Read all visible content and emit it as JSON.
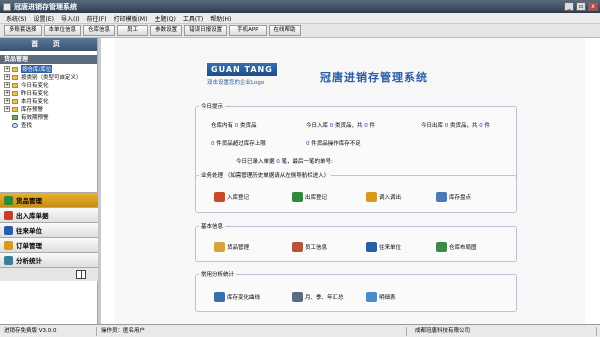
{
  "window": {
    "title": "冠唐进销存管理系统",
    "controls": [
      "_",
      "▫",
      "x"
    ]
  },
  "menubar": [
    "系统(S)",
    "设置(E)",
    "导入(I)",
    "前往(F)",
    "打印模板(M)",
    "主题(Q)",
    "工具(T)",
    "帮助(H)"
  ],
  "toolbar": [
    "多账套选择",
    "本单位信息",
    "仓库信息",
    "员工",
    "参数设置",
    "错误日报设置",
    "手机APP",
    "在线帮助"
  ],
  "sidebar": {
    "home_tab": "首 页",
    "tree_header": "货品管理",
    "tree": [
      {
        "label": "按仓库/库位",
        "expander": "+",
        "selected": true
      },
      {
        "label": "按类别（类型可自定义）",
        "expander": "+",
        "selected": false
      },
      {
        "label": "今日有变化",
        "expander": "+",
        "selected": false
      },
      {
        "label": "昨日有变化",
        "expander": "+",
        "selected": false
      },
      {
        "label": "本月有变化",
        "expander": "+",
        "selected": false
      },
      {
        "label": "库存预警",
        "expander": "+",
        "selected": false
      },
      {
        "label": "有效期预警",
        "expander": "",
        "selected": false
      },
      {
        "label": "查找",
        "expander": "",
        "selected": false
      }
    ],
    "refresh_label": "刷新",
    "accordion": [
      {
        "label": "货品管理",
        "active": true,
        "color": "#2c8a3a"
      },
      {
        "label": "出入库单据",
        "active": false,
        "color": "#c83c2a"
      },
      {
        "label": "往来单位",
        "active": false,
        "color": "#2a5ca8"
      },
      {
        "label": "订单管理",
        "active": false,
        "color": "#d89a1a"
      },
      {
        "label": "分析统计",
        "active": false,
        "color": "#3a7f9a"
      }
    ]
  },
  "main": {
    "logo_word": "GUAN TANG",
    "logo_sub": "双击设置您的企业Logo",
    "heading": "冠唐进销存管理系统",
    "today": {
      "title": "今日提示",
      "row1": [
        {
          "label": "仓库内有",
          "value": "0",
          "unit": "类货品"
        },
        {
          "label": "今日入库",
          "value": "0",
          "unit": "类货品，共",
          "value2": "0",
          "unit2": "件"
        },
        {
          "label": "今日出库",
          "value": "0",
          "unit": "类货品，共",
          "value2": "0",
          "unit2": "件"
        }
      ],
      "row2": [
        {
          "value": "0",
          "unit": "件货品超过库存上限"
        },
        {
          "value": "0",
          "unit": "件货品操作库存不足"
        }
      ],
      "row3": {
        "label": "今日已录入单据",
        "value": "0",
        "unit": "笔，最后一笔的单号:"
      }
    },
    "business": {
      "title": "业务处理 （如需管理历史单据请从左侧导航栏进入）",
      "actions": [
        "入库登记",
        "出库登记",
        "调入调出",
        "库存盘点"
      ]
    },
    "basic": {
      "title": "基本信息",
      "actions": [
        "货品管理",
        "员工信息",
        "往来单位",
        "仓库布局图"
      ]
    },
    "analysis": {
      "title": "常用分析统计",
      "actions": [
        "库存变化曲线",
        "月、季、年汇总",
        "明细表"
      ]
    }
  },
  "status": {
    "version": "进销存免费版  V3.0.0",
    "operator": "操作员：匿名用户",
    "company": "成都冠唐科技有限公司"
  }
}
